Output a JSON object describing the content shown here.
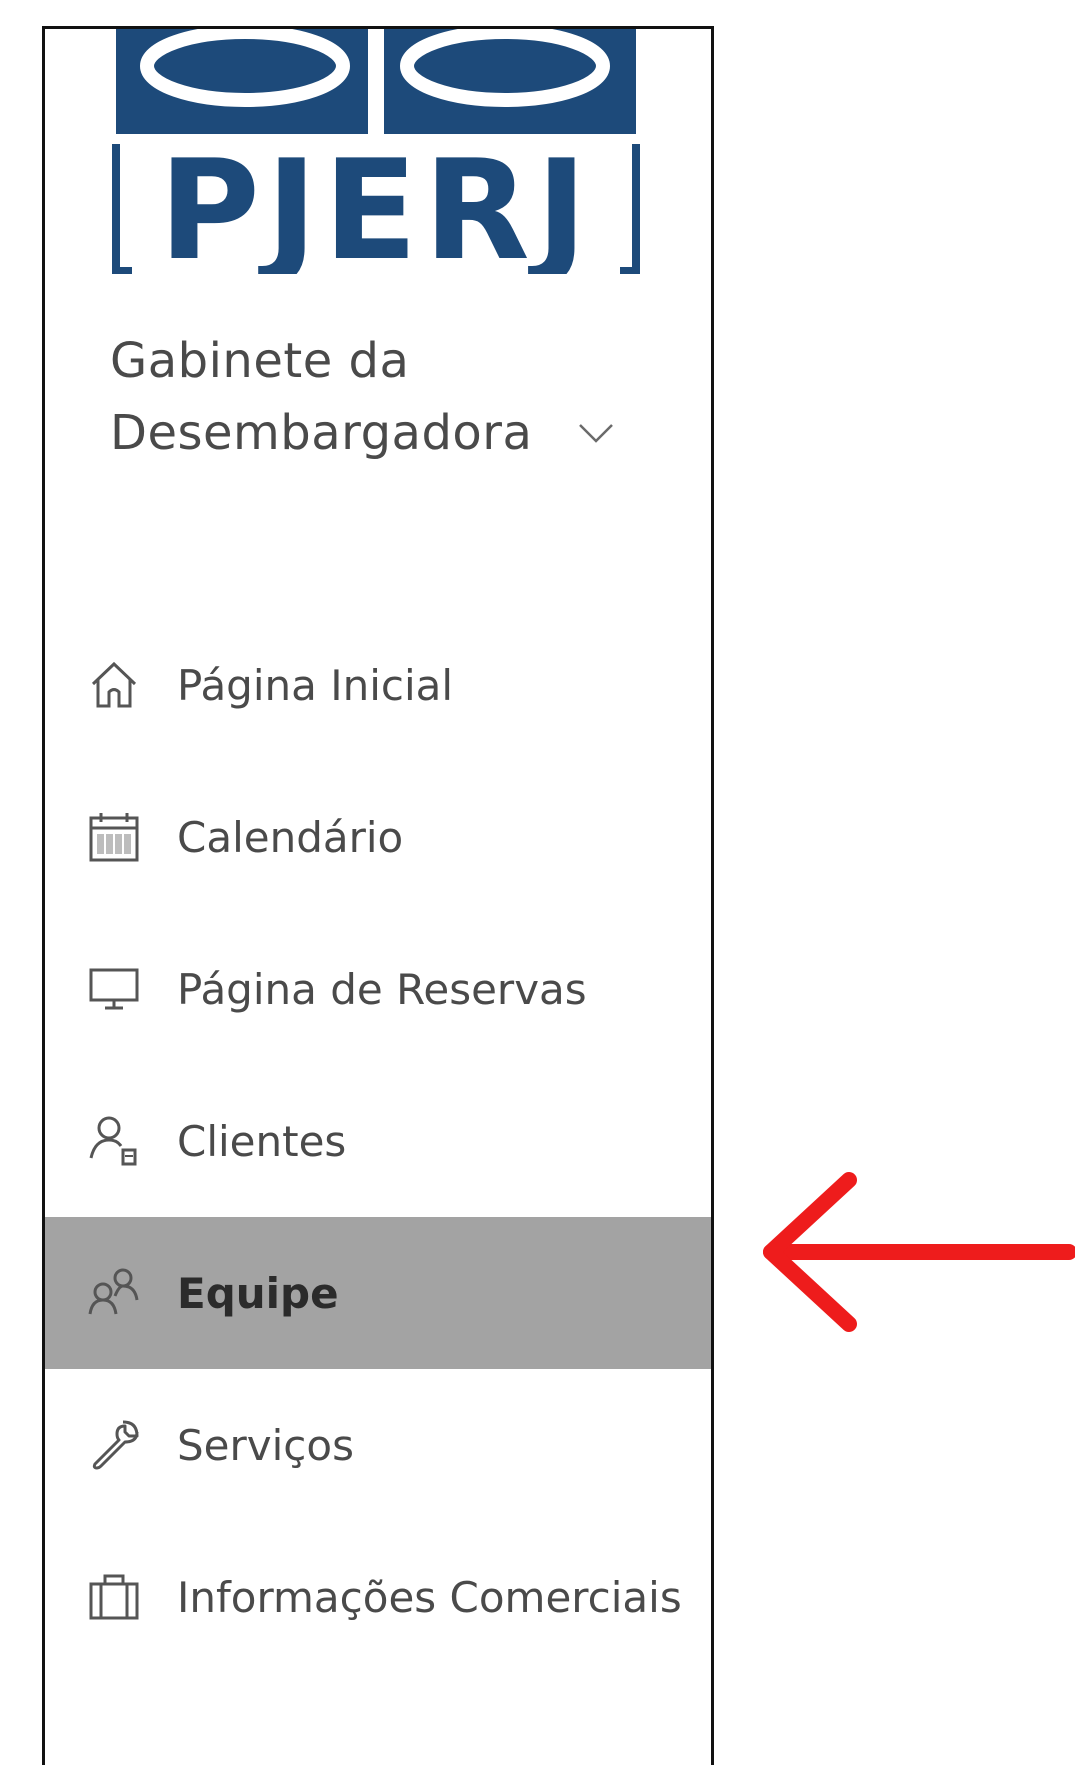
{
  "logo": {
    "text": "PJERJ",
    "color": "#1d4a7a"
  },
  "site": {
    "title_line1": "Gabinete da",
    "title_line2": "Desembargadora"
  },
  "nav": {
    "items": [
      {
        "label": "Página Inicial",
        "icon": "home-icon",
        "active": false
      },
      {
        "label": "Calendário",
        "icon": "calendar-icon",
        "active": false
      },
      {
        "label": "Página de Reservas",
        "icon": "monitor-icon",
        "active": false
      },
      {
        "label": "Clientes",
        "icon": "client-icon",
        "active": false
      },
      {
        "label": "Equipe",
        "icon": "team-icon",
        "active": true
      },
      {
        "label": "Serviços",
        "icon": "wrench-icon",
        "active": false
      },
      {
        "label": "Informações Comerciais",
        "icon": "briefcase-icon",
        "active": false
      }
    ]
  },
  "annotation": {
    "icon": "red-arrow-left-icon",
    "color": "#ee1c1c"
  },
  "colors": {
    "active_background": "#a3a3a3",
    "text": "#4a4a4a",
    "border": "#111111"
  }
}
